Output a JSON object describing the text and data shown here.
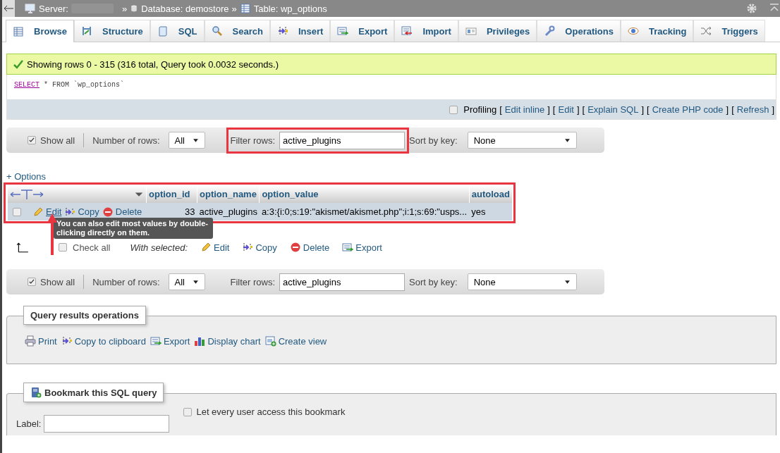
{
  "breadcrumb": {
    "separator": "»",
    "items": [
      {
        "kind": "server",
        "label": "Server:"
      },
      {
        "kind": "database",
        "label": "Database: demostore"
      },
      {
        "kind": "table",
        "label": "Table: wp_options"
      }
    ]
  },
  "tabs": [
    {
      "label": "Browse",
      "selected": true
    },
    {
      "label": "Structure",
      "selected": false
    },
    {
      "label": "SQL",
      "selected": false
    },
    {
      "label": "Search",
      "selected": false
    },
    {
      "label": "Insert",
      "selected": false
    },
    {
      "label": "Export",
      "selected": false
    },
    {
      "label": "Import",
      "selected": false
    },
    {
      "label": "Privileges",
      "selected": false
    },
    {
      "label": "Operations",
      "selected": false
    },
    {
      "label": "Tracking",
      "selected": false
    },
    {
      "label": "Triggers",
      "selected": false
    }
  ],
  "message": "Showing rows 0 - 315 (316 total, Query took 0.0032 seconds.)",
  "query": {
    "keyword": "SELECT",
    "rest": "* FROM `wp_options`"
  },
  "profiling": {
    "label": "Profiling",
    "checked": false,
    "open": "[",
    "close": "]",
    "links": [
      "Edit inline",
      "Edit",
      "Explain SQL",
      "Create PHP code",
      "Refresh"
    ]
  },
  "navbars": [
    {
      "show_all": "Show all",
      "show_all_checked": true,
      "rows_label": "Number of rows:",
      "rows_value": "All",
      "filter_label": "Filter rows:",
      "filter_value": "active_plugins",
      "sort_label": "Sort by key:",
      "sort_value": "None",
      "highlighted": true
    },
    {
      "show_all": "Show all",
      "show_all_checked": true,
      "rows_label": "Number of rows:",
      "rows_value": "All",
      "filter_label": "Filter rows:",
      "filter_value": "active_plugins",
      "sort_label": "Sort by key:",
      "sort_value": "None",
      "highlighted": false
    }
  ],
  "options_link": "+ Options",
  "table": {
    "columns": [
      "option_id",
      "option_name",
      "option_value",
      "autoload"
    ],
    "rows": [
      {
        "checked": false,
        "actions": [
          "Edit",
          "Copy",
          "Delete"
        ],
        "cells": [
          "33",
          "active_plugins",
          "a:3:{i:0;s:19:\"akismet/akismet.php\";i:1;s:69:\"usps...",
          "yes"
        ]
      }
    ]
  },
  "tooltip": "You can also edit most values by double-clicking directly on them.",
  "bulk": {
    "check_all": "Check all",
    "checked": false,
    "with_selected": "With selected:",
    "actions": [
      "Edit",
      "Copy",
      "Delete",
      "Export"
    ]
  },
  "results_ops": {
    "legend": "Query results operations",
    "actions": [
      "Print",
      "Copy to clipboard",
      "Export",
      "Display chart",
      "Create view"
    ]
  },
  "bookmark": {
    "legend": "Bookmark this SQL query",
    "label": "Label:",
    "shared_label": "Let every user access this bookmark",
    "shared_checked": false
  }
}
